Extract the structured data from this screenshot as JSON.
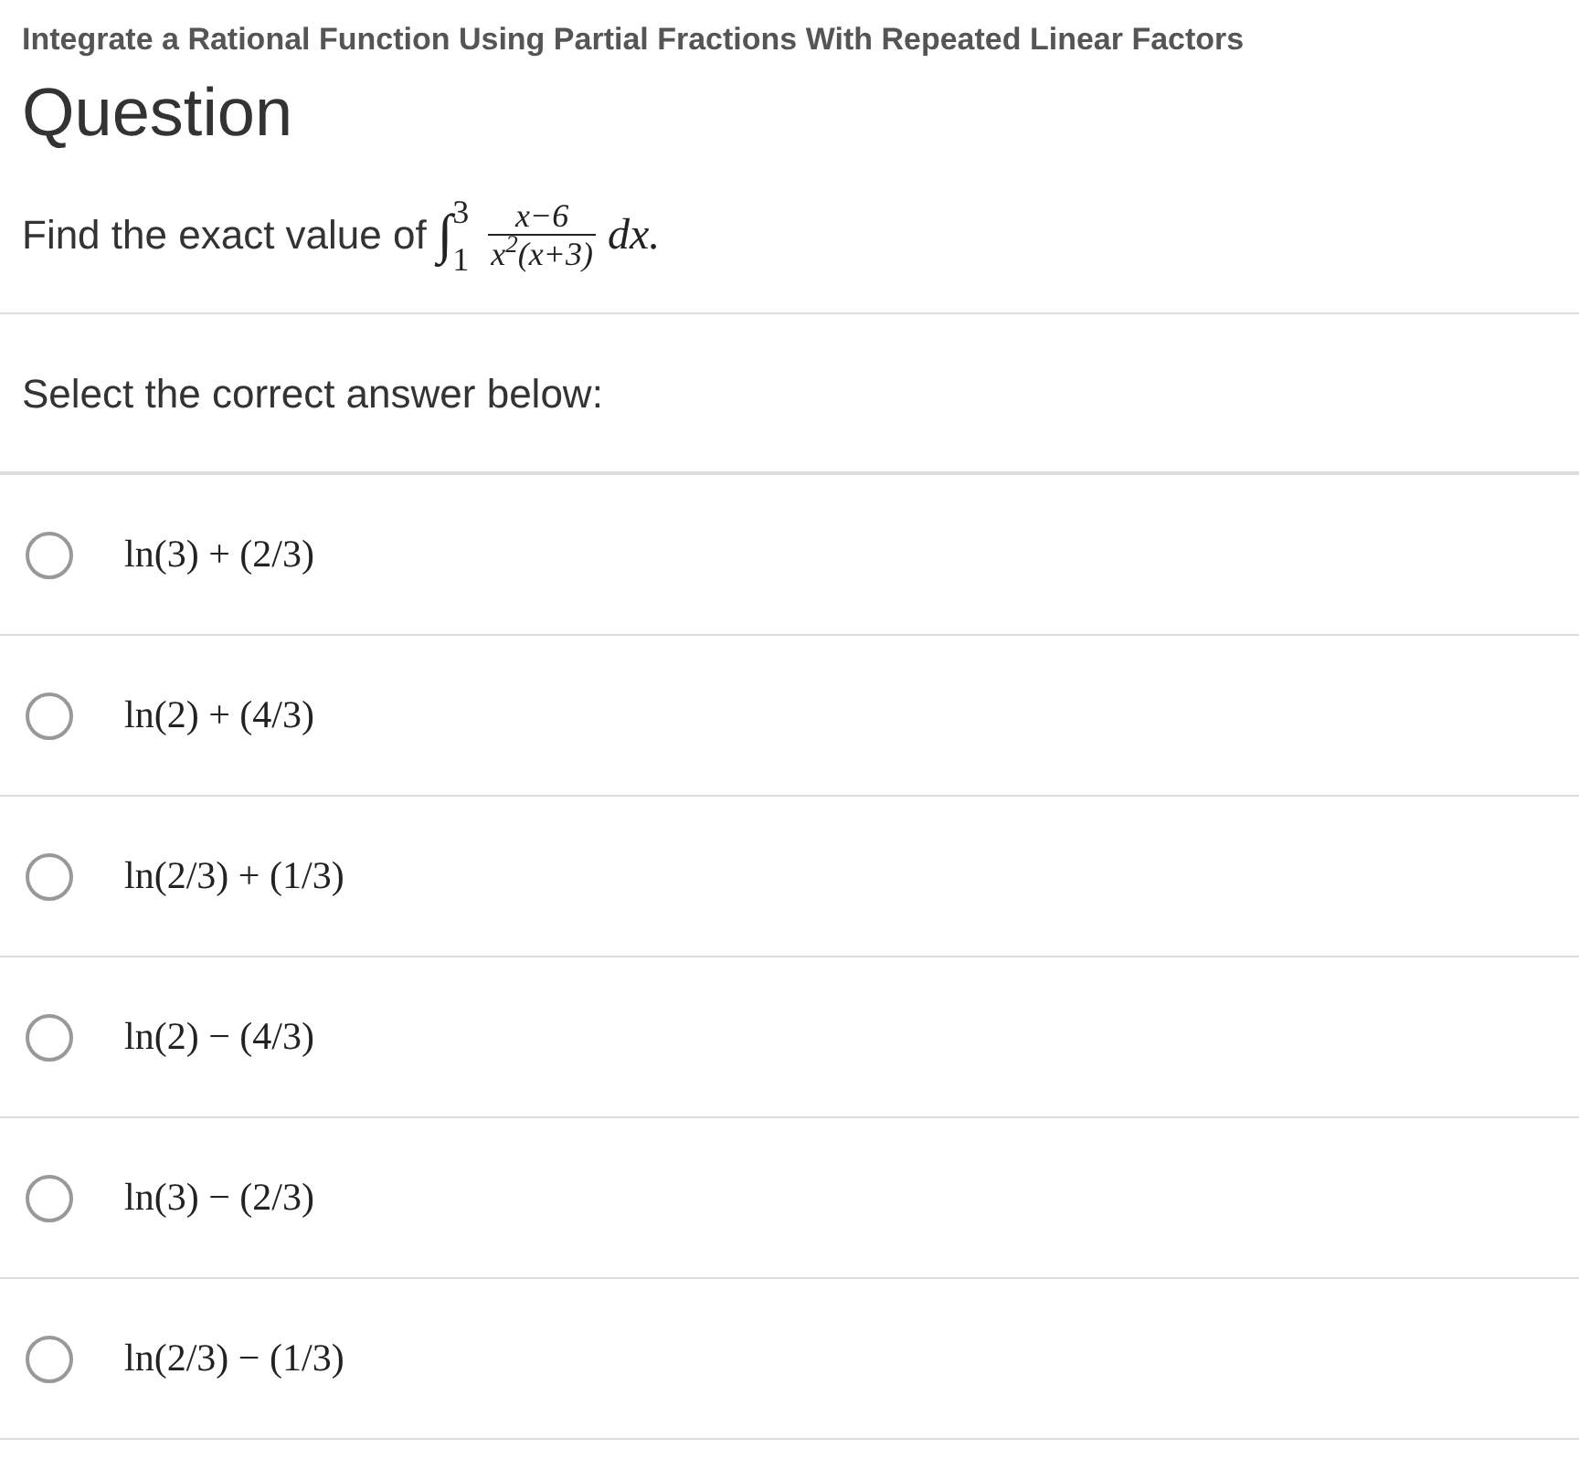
{
  "topic_title": "Integrate a Rational Function Using Partial Fractions With Repeated Linear Factors",
  "heading": "Question",
  "question": {
    "prefix": "Find the exact value of",
    "integral": {
      "sign": "∫",
      "lower": "1",
      "upper": "3",
      "numerator": "x−6",
      "denominator": "x$^{2}$(x+3)",
      "differential": "dx."
    }
  },
  "prompt": "Select the correct answer below:",
  "options": [
    {
      "text": "ln(3) + (2/3)",
      "selected": false
    },
    {
      "text": "ln(2) + (4/3)",
      "selected": false
    },
    {
      "text": "ln(2/3) + (1/3)",
      "selected": false
    },
    {
      "text": "ln(2) − (4/3)",
      "selected": false
    },
    {
      "text": "ln(3) − (2/3)",
      "selected": false
    },
    {
      "text": "ln(2/3) − (1/3)",
      "selected": false
    }
  ]
}
